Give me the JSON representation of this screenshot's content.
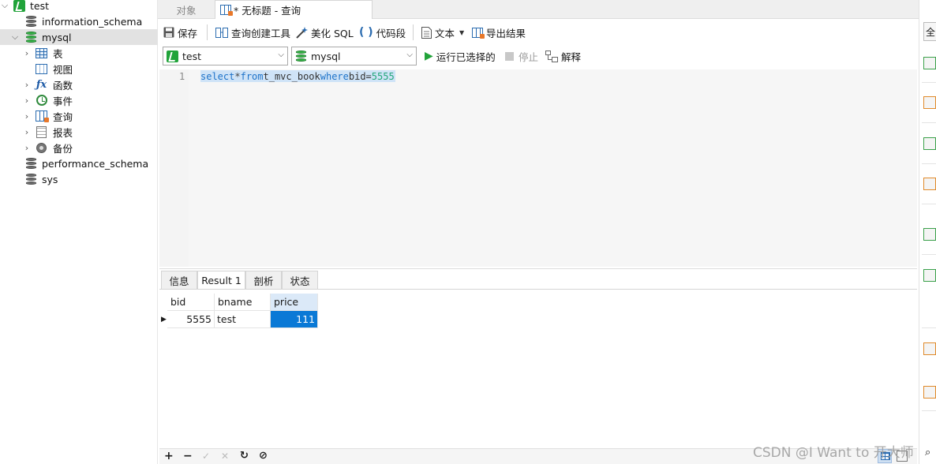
{
  "sidebar": {
    "connection": "test",
    "items": [
      {
        "label": "information_schema",
        "icon": "database-icon"
      },
      {
        "label": "mysql",
        "icon": "database-icon",
        "selected": true
      },
      {
        "label": "表",
        "icon": "table-icon"
      },
      {
        "label": "视图",
        "icon": "view-icon"
      },
      {
        "label": "函数",
        "icon": "function-icon"
      },
      {
        "label": "事件",
        "icon": "event-icon"
      },
      {
        "label": "查询",
        "icon": "query-icon"
      },
      {
        "label": "报表",
        "icon": "report-icon"
      },
      {
        "label": "备份",
        "icon": "backup-icon"
      },
      {
        "label": "performance_schema",
        "icon": "database-icon"
      },
      {
        "label": "sys",
        "icon": "database-icon"
      }
    ]
  },
  "tabs": {
    "objects": "对象",
    "query_tab": "* 无标题 - 查询"
  },
  "toolbar": {
    "save": "保存",
    "query_builder": "查询创建工具",
    "beautify_sql": "美化 SQL",
    "code_snippet": "代码段",
    "text": "文本",
    "export_results": "导出结果"
  },
  "runbar": {
    "connection_value": "test",
    "database_value": "mysql",
    "run_selected": "运行已选择的",
    "stop": "停止",
    "explain": "解释"
  },
  "editor": {
    "line_number": "1",
    "kw_select": "select",
    "star": "*",
    "kw_from": "from",
    "table": "t_mvc_book",
    "kw_where": "where",
    "condition": "bid=",
    "literal": "5555"
  },
  "results": {
    "tabs": [
      "信息",
      "Result 1",
      "剖析",
      "状态"
    ],
    "active_tab": "Result 1",
    "columns": [
      "bid",
      "bname",
      "price"
    ],
    "rows": [
      [
        "5555",
        "test",
        "111"
      ]
    ]
  },
  "watermark": "CSDN @I Want to 开大师",
  "right_panel": {
    "label": "全"
  },
  "colors": {
    "keyword": "#1e73c9",
    "selection": "#cfe3f7",
    "selected_cell": "#0a79d6",
    "accent_green": "#22a33a"
  }
}
